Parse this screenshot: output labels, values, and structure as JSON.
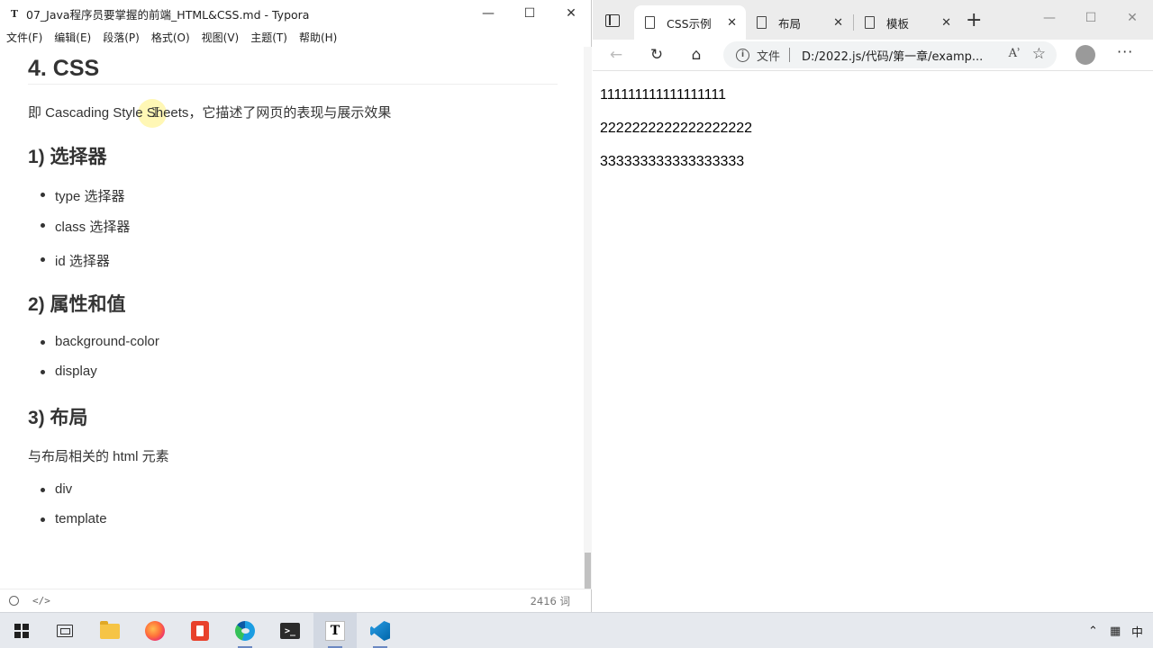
{
  "typora": {
    "app_icon": "T",
    "title": "07_Java程序员要掌握的前端_HTML&CSS.md - Typora",
    "menu": [
      "文件(F)",
      "编辑(E)",
      "段落(P)",
      "格式(O)",
      "视图(V)",
      "主题(T)",
      "帮助(H)"
    ],
    "document": {
      "h1": "4. CSS",
      "intro": "即 Cascading  Style Sheets，它描述了网页的表现与展示效果",
      "sections": [
        {
          "heading": "1) 选择器",
          "items": [
            "type 选择器",
            "class 选择器",
            "id 选择器"
          ]
        },
        {
          "heading": "2) 属性和值",
          "items": [
            "background-color",
            "display"
          ]
        },
        {
          "heading": "3) 布局",
          "paragraph": "与布局相关的 html 元素",
          "items": [
            "div",
            "template"
          ]
        }
      ]
    },
    "status": {
      "source_icon": "</>",
      "word_count": "2416 词"
    }
  },
  "edge": {
    "tabs": [
      {
        "label": "CSS示例",
        "active": true
      },
      {
        "label": "布局",
        "active": false
      },
      {
        "label": "模板",
        "active": false
      }
    ],
    "address": {
      "chip": "文件",
      "url": "D:/2022.js/代码/第一章/examp...",
      "read_aloud": "Aʾ"
    },
    "page_lines": [
      "111111111111111111",
      "2222222222222222222",
      "333333333333333333"
    ]
  },
  "taskbar": {
    "ime_label": "中",
    "icons": [
      "start-icon",
      "task-view-icon",
      "file-explorer-icon",
      "firefox-icon",
      "office-icon",
      "edge-icon",
      "terminal-icon",
      "typora-icon",
      "vscode-icon"
    ]
  }
}
